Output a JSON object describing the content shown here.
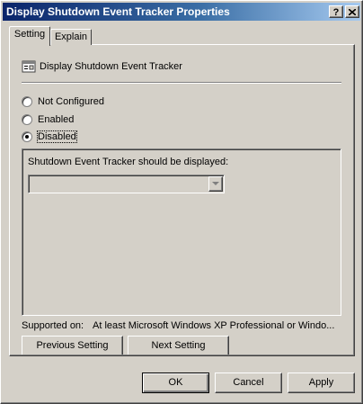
{
  "window": {
    "title": "Display Shutdown Event Tracker Properties",
    "help_label": "?"
  },
  "tabs": [
    {
      "label": "Setting",
      "active": true
    },
    {
      "label": "Explain",
      "active": false
    }
  ],
  "policy": {
    "icon": "policy-setting-icon",
    "title": "Display Shutdown Event Tracker"
  },
  "radios": [
    {
      "label": "Not Configured",
      "selected": false
    },
    {
      "label": "Enabled",
      "selected": false
    },
    {
      "label": "Disabled",
      "selected": true
    }
  ],
  "options": {
    "label": "Shutdown Event Tracker should be displayed:",
    "dropdown_value": ""
  },
  "supported": {
    "label": "Supported on:",
    "value": "At least Microsoft Windows XP Professional or Windo..."
  },
  "nav_buttons": {
    "previous": "Previous Setting",
    "next": "Next Setting"
  },
  "dialog_buttons": {
    "ok": "OK",
    "cancel": "Cancel",
    "apply": "Apply"
  },
  "colors": {
    "title_start": "#0a246a",
    "title_end": "#a6caf0",
    "face": "#d4d0c8"
  }
}
